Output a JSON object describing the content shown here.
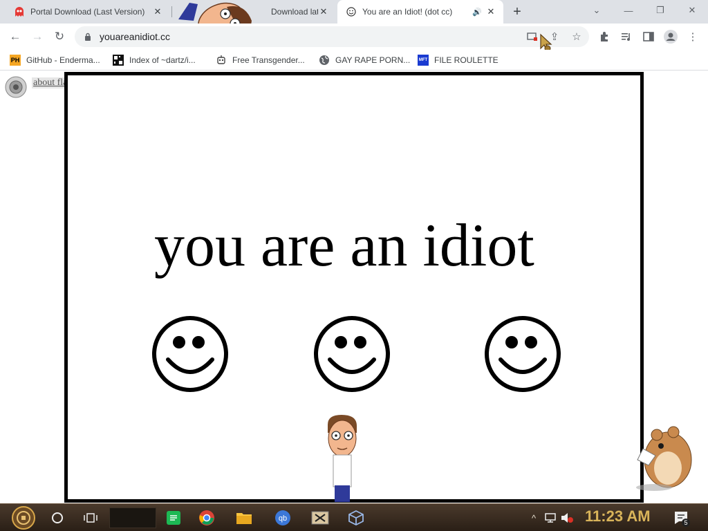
{
  "tabs": [
    {
      "title": "Portal Download (Last Version)",
      "icon": "ghost-icon",
      "active": false
    },
    {
      "title": "Download latest ve...",
      "icon": "page-icon",
      "active": false
    },
    {
      "title": "You are an Idiot! (dot cc)",
      "icon": "smiley-icon",
      "active": true,
      "audio": true
    }
  ],
  "window": {
    "new_tab": "+",
    "minimize": "—",
    "restore": "❐",
    "close": "✕",
    "tab_search": "⌄"
  },
  "toolbar": {
    "url": "youareanidiot.cc",
    "back": "←",
    "forward": "→",
    "reload": "↻"
  },
  "bookmarks": [
    {
      "label": "GitHub - Enderma...",
      "icon": "PH"
    },
    {
      "label": "Index of ~dartz/i...",
      "icon": "grid"
    },
    {
      "label": "Free Transgender...",
      "icon": "robot"
    },
    {
      "label": "GAY RAPE PORN...",
      "icon": "globe"
    },
    {
      "label": "FILE ROULETTE",
      "icon": "MFT"
    }
  ],
  "page": {
    "headline": "you are an idiot",
    "flash_link": "about flash",
    "smiley_count": 3
  },
  "taskbar": {
    "clock": "11:23 AM",
    "notification_count": "5"
  },
  "colors": {
    "tabstrip": "#dee1e6",
    "omnibox": "#f1f3f4",
    "clock": "#d9b45a",
    "taskbar": "#3a2d22"
  }
}
